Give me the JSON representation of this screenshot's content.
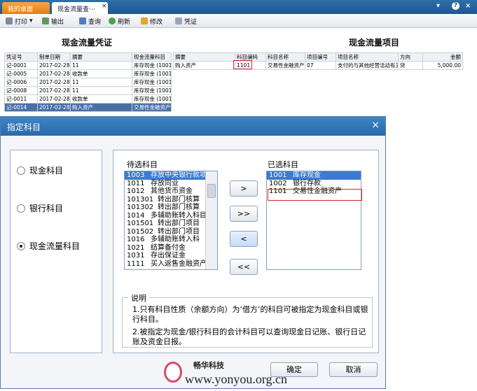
{
  "tabs": {
    "home": "我的桌面",
    "cashflow": "现金流量查⋯",
    "close_glyph": "×"
  },
  "window_buttons": {
    "dropdown": "▾",
    "help": "?",
    "close": "×"
  },
  "toolbar": {
    "print": "打印",
    "print_caret": "▾",
    "export": "输出",
    "query": "查询",
    "refresh": "刷新",
    "edit": "修改",
    "voucher": "凭证"
  },
  "left_title": "现金流量凭证",
  "right_title": "现金流量项目",
  "voucher_table": {
    "headers": [
      "凭证号",
      "制单日期",
      "摘要",
      "现金流量科目"
    ],
    "rows": [
      [
        "记-0001",
        "2017-02-28",
        "11",
        "库存现金 (1001)"
      ],
      [
        "记-0005",
        "2017-02-28",
        "收款单",
        "库存现金 (1001)"
      ],
      [
        "记-0006",
        "2017-02-28",
        "11",
        "库存现金 (1001)"
      ],
      [
        "记-0008",
        "2017-02-28",
        "11",
        "库存现金 (1001)"
      ],
      [
        "记-0011",
        "2017-02-28",
        "收款单",
        "库存现金 (1001)"
      ],
      [
        "记-0014",
        "2017-02-28",
        "购入资产",
        "交易性金融资产"
      ]
    ],
    "selected_row": 5
  },
  "item_table": {
    "headers": [
      "摘要",
      "科目编码",
      "科目名称",
      "项目编号",
      "项目名称",
      "方向",
      "金额"
    ],
    "rows": [
      [
        "购入资产",
        "1101",
        "交易性金融资产",
        "07",
        "支付的与其他经营活动有关",
        "贷",
        "5,000.00"
      ]
    ]
  },
  "dialog": {
    "title": "指定科目",
    "close_glyph": "×",
    "radios": [
      {
        "label": "现金科目",
        "checked": false
      },
      {
        "label": "银行科目",
        "checked": false
      },
      {
        "label": "现金流量科目",
        "checked": true
      }
    ],
    "available_label": "待选科目",
    "available": [
      {
        "code": "1003",
        "name": "存放中央银行款项"
      },
      {
        "code": "1011",
        "name": "存放同业"
      },
      {
        "code": "1012",
        "name": "其他货币资金"
      },
      {
        "code": "101301",
        "name": "转出部门核算"
      },
      {
        "code": "101302",
        "name": "转出部门核算"
      },
      {
        "code": "1014",
        "name": "多辅助账转入科目"
      },
      {
        "code": "101501",
        "name": "转出部门项目"
      },
      {
        "code": "101502",
        "name": "转出部门项目"
      },
      {
        "code": "1016",
        "name": "多辅助账转入科"
      },
      {
        "code": "1021",
        "name": "结算备付金"
      },
      {
        "code": "1031",
        "name": "存出保证金"
      },
      {
        "code": "1111",
        "name": "买入返售金融资产"
      }
    ],
    "selected_label": "已选科目",
    "selected": [
      {
        "code": "1001",
        "name": "库存现金"
      },
      {
        "code": "1002",
        "name": "银行存款"
      },
      {
        "code": "1101",
        "name": "交易性金融资产"
      }
    ],
    "move_buttons": [
      ">",
      ">>",
      "<",
      "<<"
    ],
    "note_title": "说明",
    "note_1": "1.只有科目性质（余额方向）为‘借方’的科目可被指定为现金科目或银行科目。",
    "note_2": "2.被指定为现金/银行科目的会计科目可以查询现金日记账、银行日记账及资金日报。",
    "ok": "确定",
    "cancel": "取消"
  },
  "watermark": {
    "brand": "畅华科技",
    "url": "www.yonyou.org.cn"
  }
}
